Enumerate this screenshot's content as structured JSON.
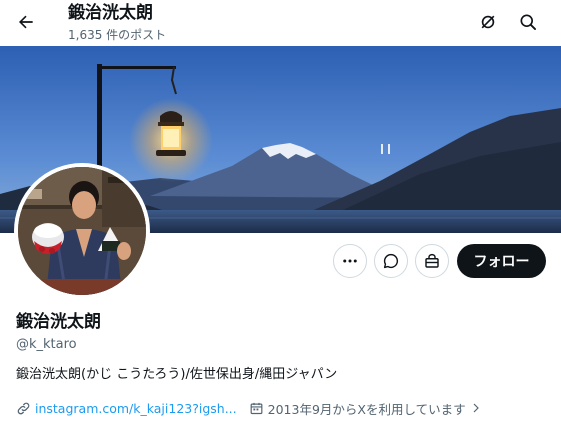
{
  "header": {
    "title": "鍛治洸太朗",
    "post_count": "1,635 件のポスト"
  },
  "profile": {
    "display_name": "鍛治洸太朗",
    "handle": "@k_ktaro",
    "bio": "鍛治洸太朗(かじ こうたろう)/佐世保出身/縄田ジャパン",
    "link": "instagram.com/k_kaji123?igsh...",
    "joined": "2013年9月からXを利用しています"
  },
  "actions": {
    "follow_label": "フォロー"
  },
  "colors": {
    "accent": "#1d9bf0",
    "text": "#0f1419",
    "muted": "#536471",
    "follow_bg": "#0f1419"
  },
  "icons": [
    "back-arrow-icon",
    "grok-icon",
    "search-icon",
    "more-icon",
    "message-icon",
    "shop-icon",
    "link-icon",
    "calendar-icon",
    "chevron-right-icon"
  ]
}
